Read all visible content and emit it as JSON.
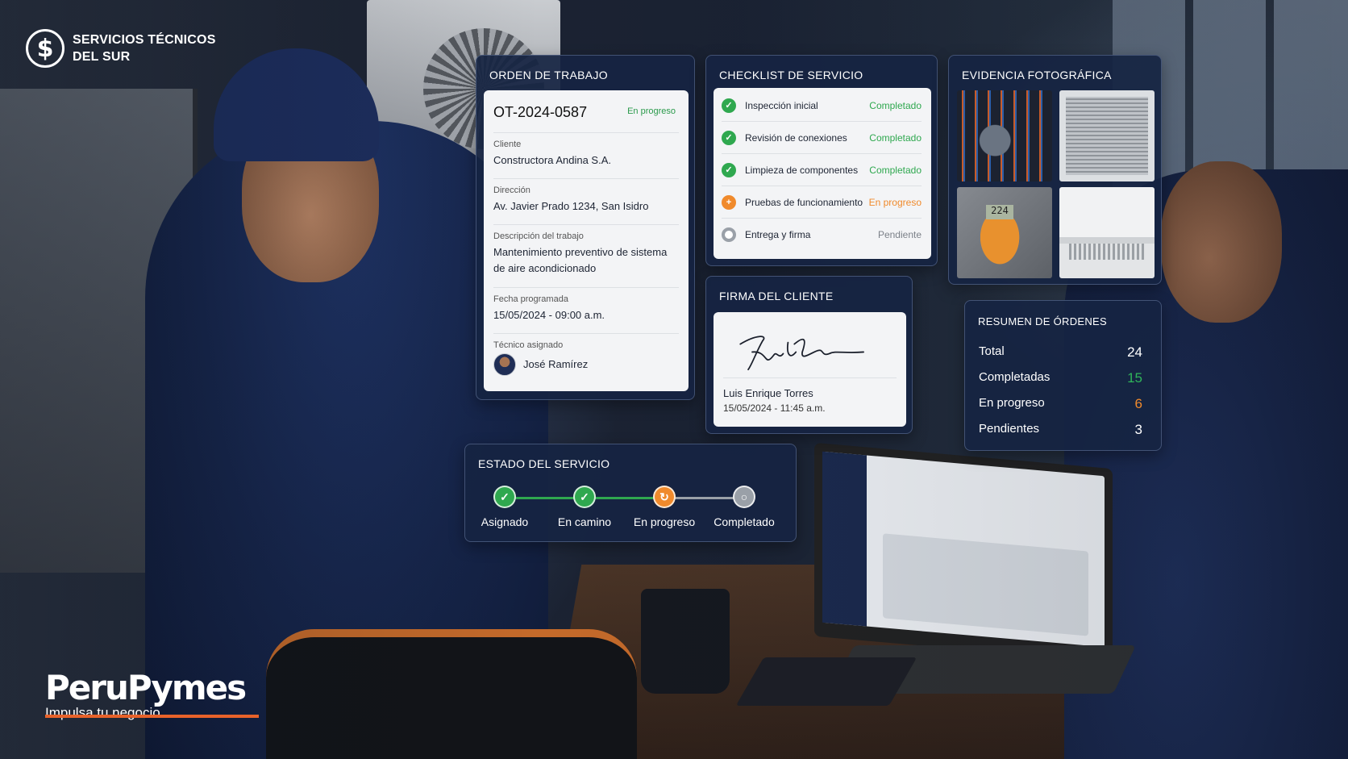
{
  "brand": {
    "company_line1": "SERVICIOS TÉCNICOS",
    "company_line2": "DEL SUR",
    "logo_symbol": "$",
    "footer_name": "PeruPymes",
    "footer_tagline": "Impulsa tu negocio"
  },
  "orden": {
    "title": "ORDEN DE TRABAJO",
    "code": "OT-2024-0587",
    "status": "En progreso",
    "fields": [
      {
        "label": "Cliente",
        "value": "Constructora Andina S.A."
      },
      {
        "label": "Dirección",
        "value": "Av. Javier Prado 1234, San Isidro"
      },
      {
        "label": "Descripción del trabajo",
        "value": "Mantenimiento preventivo de sistema de aire acondicionado"
      },
      {
        "label": "Fecha programada",
        "value": "15/05/2024 - 09:00 a.m."
      }
    ],
    "tech_label": "Técnico asignado",
    "tech_name": "José Ramírez"
  },
  "checklist": {
    "title": "CHECKLIST DE SERVICIO",
    "items": [
      {
        "label": "Inspección inicial",
        "status": "Completado",
        "state": "done",
        "icon": "check-icon"
      },
      {
        "label": "Revisión de conexiones",
        "status": "Completado",
        "state": "done",
        "icon": "check-icon"
      },
      {
        "label": "Limpieza de componentes",
        "status": "Completado",
        "state": "done",
        "icon": "check-icon"
      },
      {
        "label": "Pruebas de funcionamiento",
        "status": "En progreso",
        "state": "progress",
        "icon": "progress-icon"
      },
      {
        "label": "Entrega y firma",
        "status": "Pendiente",
        "state": "pending",
        "icon": "pending-icon"
      }
    ]
  },
  "evidencia": {
    "title": "EVIDENCIA FOTOGRÁFICA"
  },
  "firma": {
    "title": "FIRMA DEL CLIENTE",
    "name": "Luis Enrique Torres",
    "datetime": "15/05/2024 - 11:45 a.m."
  },
  "resumen": {
    "title": "RESUMEN DE ÓRDENES",
    "rows": [
      {
        "label": "Total",
        "value": "24",
        "color": "#ffffff"
      },
      {
        "label": "Completadas",
        "value": "15",
        "color": "#2fb45a"
      },
      {
        "label": "En progreso",
        "value": "6",
        "color": "#f08a2c"
      },
      {
        "label": "Pendientes",
        "value": "3",
        "color": "#ffffff"
      }
    ]
  },
  "estado": {
    "title": "ESTADO DEL SERVICIO",
    "steps": [
      {
        "label": "Asignado",
        "state": "done"
      },
      {
        "label": "En camino",
        "state": "done"
      },
      {
        "label": "En progreso",
        "state": "progress"
      },
      {
        "label": "Completado",
        "state": "pending"
      }
    ]
  },
  "colors": {
    "done": "#2fa84f",
    "progress": "#f08a2c",
    "pending": "#9aa0a8",
    "accent": "#e8622a"
  }
}
